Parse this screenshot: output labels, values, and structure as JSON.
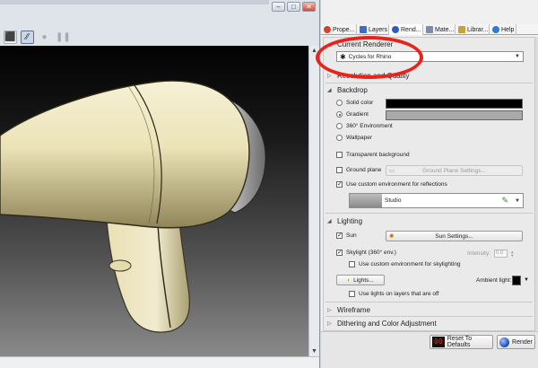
{
  "viewport": {
    "window_controls": {
      "minimize": "–",
      "maximize": "□",
      "close": "✕"
    },
    "toolbar": [
      {
        "icon": "cube-icon",
        "glyph": "⬛",
        "state": "normal"
      },
      {
        "icon": "raytrace-wand-icon",
        "glyph": "⁄⁄",
        "state": "active"
      },
      {
        "icon": "record-icon",
        "glyph": "●",
        "state": "dim"
      },
      {
        "icon": "pause-icon",
        "glyph": "❚❚",
        "state": "dim"
      }
    ],
    "scroll_up": "▲",
    "scroll_down": "▼"
  },
  "panel": {
    "tabs": [
      {
        "label": "Prope...",
        "icon": "properties-icon",
        "color": "#d0452b",
        "active": false
      },
      {
        "label": "Layers",
        "icon": "layers-icon",
        "color": "#3b6fc4",
        "active": false
      },
      {
        "label": "Rend...",
        "icon": "render-icon",
        "color": "#2a5fc0",
        "active": true
      },
      {
        "label": "Mate...",
        "icon": "materials-icon",
        "color": "#7a8ea8",
        "active": false
      },
      {
        "label": "Librar...",
        "icon": "libraries-icon",
        "color": "#c7a23a",
        "active": false
      },
      {
        "label": "Help",
        "icon": "help-icon",
        "color": "#2a7bd5",
        "active": false
      }
    ],
    "current_renderer": {
      "title": "Current Renderer",
      "value": "Cycles for Rhino"
    },
    "resolution_quality": {
      "title": "Resolution and Quality"
    },
    "backdrop": {
      "title": "Backdrop",
      "options": [
        {
          "label": "Solid color",
          "selected": false
        },
        {
          "label": "Gradient",
          "selected": true
        },
        {
          "label": "360° Environment",
          "selected": false
        },
        {
          "label": "Wallpaper",
          "selected": false
        }
      ],
      "solid_color": "#000000",
      "gradient_color": "#a9a9a9",
      "transparent_background": "Transparent background",
      "ground_plane": "Ground plane",
      "ground_plane_settings": "Ground Plane Settings...",
      "use_custom_env": "Use custom environment for reflections",
      "environment_name": "Studio"
    },
    "lighting": {
      "title": "Lighting",
      "sun": "Sun",
      "sun_settings": "Sun Settings...",
      "skylight": "Skylight (360° env.)",
      "intensity_label": "Intensity:",
      "intensity_value": "0.0",
      "use_custom_skylight": "Use custom environment for skylighting",
      "lights_button": "Lights...",
      "ambient_label": "Ambient light:",
      "ambient_color": "#000000",
      "use_lights_on_layers_off": "Use lights on layers that are off"
    },
    "wireframe": {
      "title": "Wireframe"
    },
    "dithering": {
      "title": "Dithering and Color Adjustment"
    },
    "footer": {
      "reset_label": "Reset To Defaults",
      "reset_icon_text": "00",
      "render_label": "Render"
    }
  },
  "annotation_color": "#e8231b"
}
